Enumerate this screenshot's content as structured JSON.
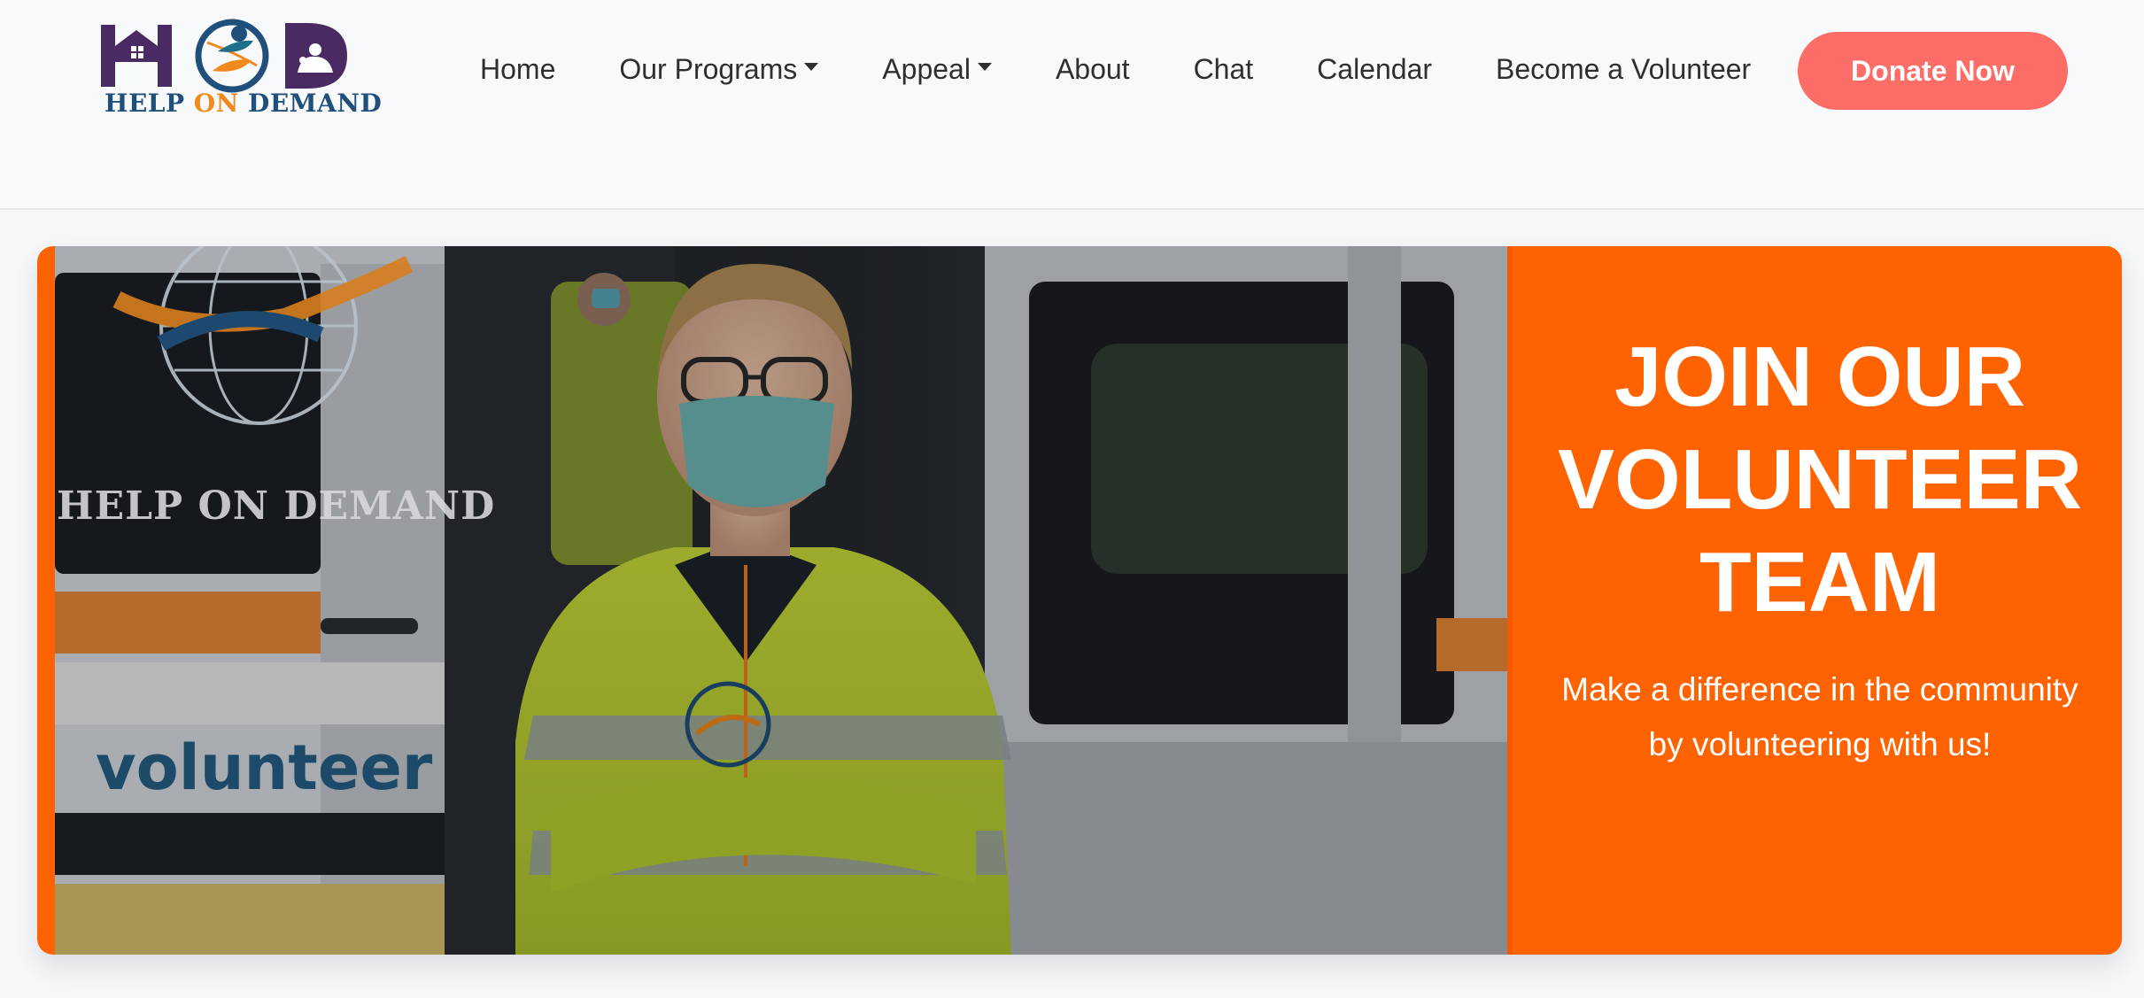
{
  "brand": {
    "logo_word1": "HELP",
    "logo_word2": "ON",
    "logo_word3": "DEMAND",
    "colors": {
      "purple": "#4a2a63",
      "blue": "#1f4f7a",
      "orange": "#f08a1c"
    }
  },
  "nav": {
    "items": [
      {
        "label": "Home",
        "dropdown": false
      },
      {
        "label": "Our Programs",
        "dropdown": true
      },
      {
        "label": "Appeal",
        "dropdown": true
      },
      {
        "label": "About",
        "dropdown": false
      },
      {
        "label": "Chat",
        "dropdown": false
      },
      {
        "label": "Calendar",
        "dropdown": false
      },
      {
        "label": "Become a Volunteer",
        "dropdown": false
      }
    ],
    "donate_label": "Donate Now",
    "donate_color": "#fb6d66"
  },
  "hero": {
    "title": "JOIN OUR\nVOLUNTEER\nTEAM",
    "subtitle": "Make a difference in the community by volunteering with us!",
    "panel_color": "#ff6201",
    "image": {
      "overlay_logo_text": "HELP ON DEMAND",
      "van_text": "volunteer"
    }
  }
}
